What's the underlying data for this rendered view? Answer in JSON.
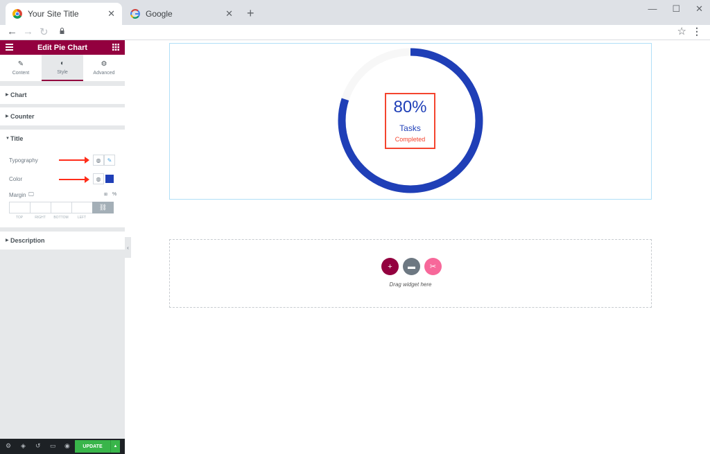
{
  "browser": {
    "tabs": [
      {
        "title": "Your Site Title",
        "active": true
      },
      {
        "title": "Google",
        "active": false
      }
    ],
    "new_tab": "+",
    "close_glyph": "✕"
  },
  "panel": {
    "header_title": "Edit Pie Chart",
    "tabs": [
      {
        "label": "Content",
        "icon": "pencil-icon"
      },
      {
        "label": "Style",
        "icon": "half-circle-icon"
      },
      {
        "label": "Advanced",
        "icon": "gear-icon"
      }
    ],
    "sections": {
      "chart": "Chart",
      "counter": "Counter",
      "title": "Title",
      "description": "Description"
    },
    "controls": {
      "typography": "Typography",
      "color": "Color",
      "margin": "Margin",
      "margin_unit": "%",
      "margin_labels": [
        "TOP",
        "RIGHT",
        "BOTTOM",
        "LEFT"
      ]
    },
    "footer": {
      "update_label": "UPDATE"
    }
  },
  "canvas": {
    "pie": {
      "percent_label": "80%",
      "percent_value": 80,
      "title": "Tasks",
      "description": "Completed",
      "bar_color": "#1f3fb7",
      "track_color": "#f7f7f7"
    },
    "dropzone": {
      "text": "Drag widget here"
    }
  },
  "colors": {
    "accent": "#93003f",
    "title_color": "#1f3fb7",
    "highlight_red": "#f4442e",
    "update_green": "#39b54a"
  }
}
